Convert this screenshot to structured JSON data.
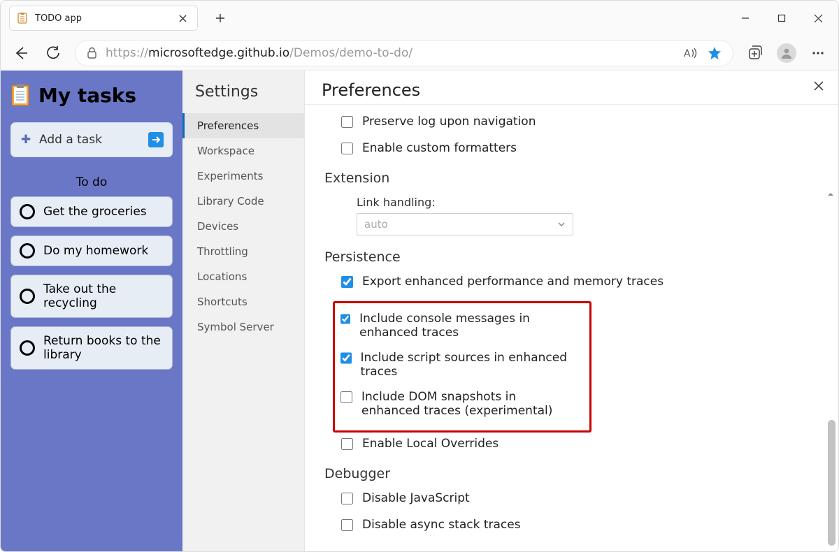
{
  "browser": {
    "tab_title": "TODO app",
    "url_pre": "https://",
    "url_host": "microsoftedge.github.io",
    "url_path": "/Demos/demo-to-do/"
  },
  "app": {
    "title": "My tasks",
    "add_task_label": "Add a task",
    "todo_header": "To do",
    "tasks": [
      {
        "label": "Get the groceries"
      },
      {
        "label": "Do my homework"
      },
      {
        "label": "Take out the recycling"
      },
      {
        "label": "Return books to the library"
      }
    ]
  },
  "settings": {
    "title": "Settings",
    "items": [
      {
        "label": "Preferences",
        "active": true
      },
      {
        "label": "Workspace"
      },
      {
        "label": "Experiments"
      },
      {
        "label": "Library Code"
      },
      {
        "label": "Devices"
      },
      {
        "label": "Throttling"
      },
      {
        "label": "Locations"
      },
      {
        "label": "Shortcuts"
      },
      {
        "label": "Symbol Server"
      }
    ]
  },
  "prefs": {
    "title": "Preferences",
    "preserve_log": {
      "label": "Preserve log upon navigation",
      "checked": false
    },
    "custom_formatters": {
      "label": "Enable custom formatters",
      "checked": false
    },
    "extension_header": "Extension",
    "link_handling_label": "Link handling:",
    "link_handling_value": "auto",
    "persistence_header": "Persistence",
    "export_enhanced": {
      "label": "Export enhanced performance and memory traces",
      "checked": true
    },
    "include_console": {
      "label": "Include console messages in enhanced traces",
      "checked": true
    },
    "include_scripts": {
      "label": "Include script sources in enhanced traces",
      "checked": true
    },
    "include_dom": {
      "label": "Include DOM snapshots in enhanced traces (experimental)",
      "checked": false
    },
    "local_overrides": {
      "label": "Enable Local Overrides",
      "checked": false
    },
    "debugger_header": "Debugger",
    "disable_js": {
      "label": "Disable JavaScript",
      "checked": false
    },
    "disable_async": {
      "label": "Disable async stack traces",
      "checked": false
    }
  }
}
